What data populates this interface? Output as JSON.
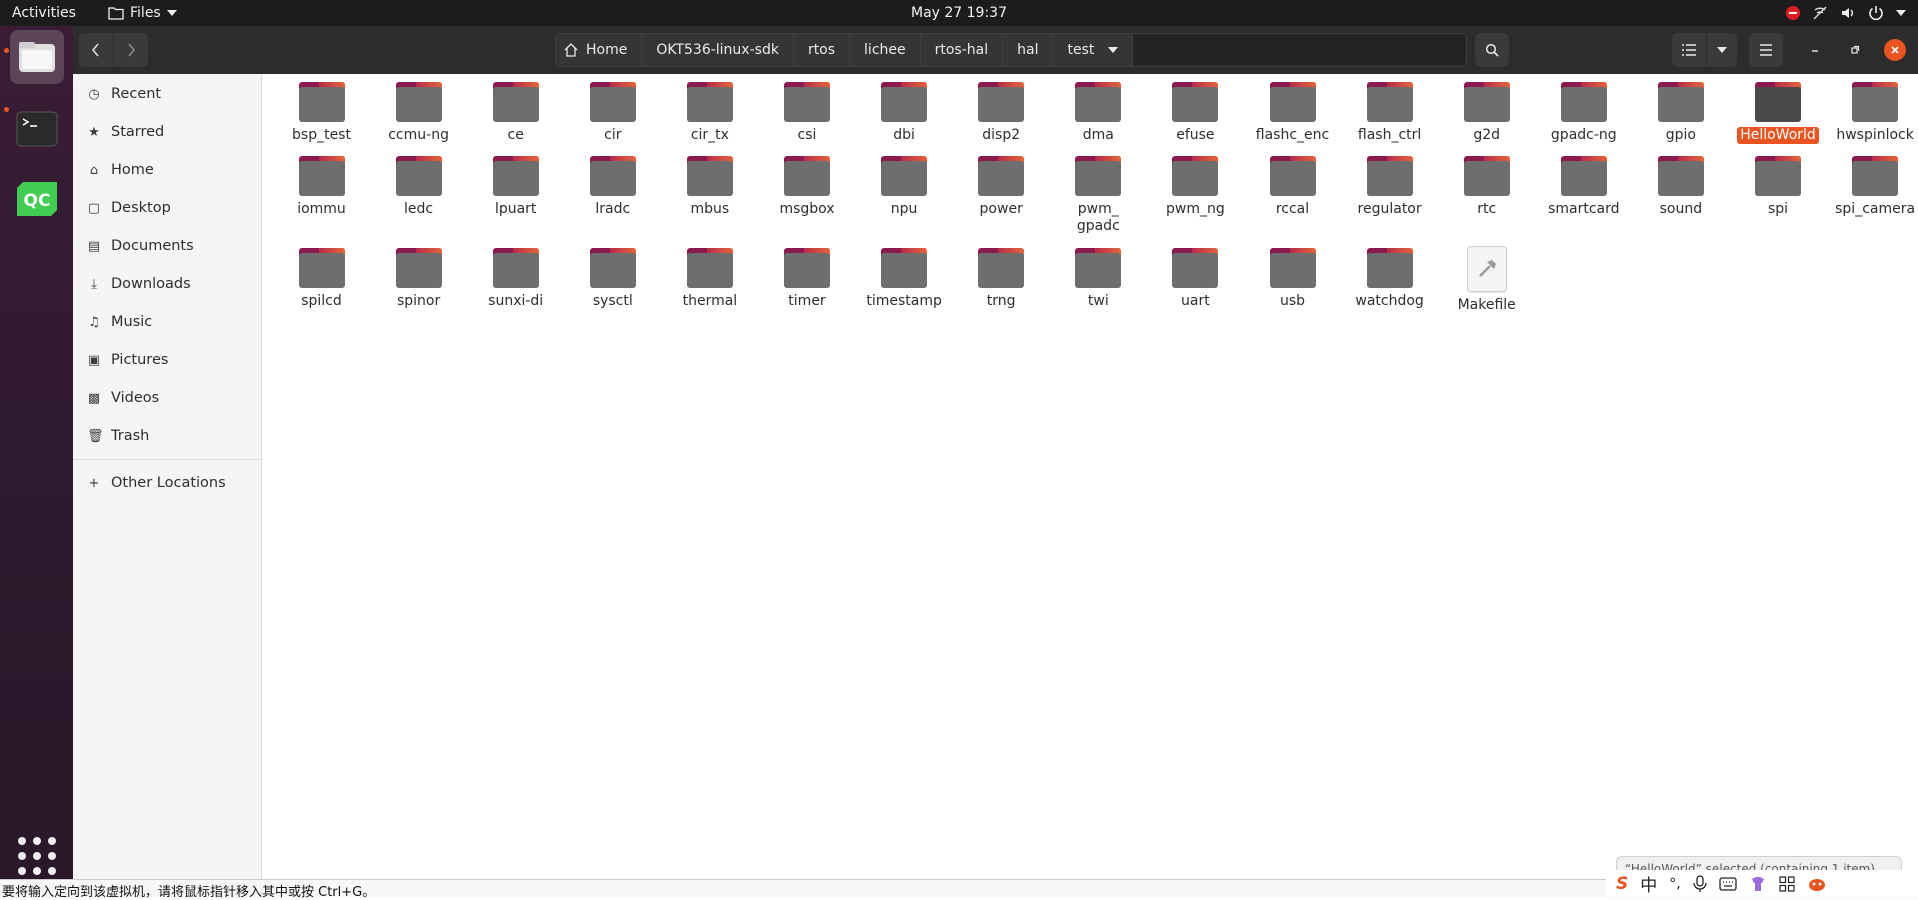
{
  "topbar": {
    "activities": "Activities",
    "app_menu": "Files",
    "clock": "May 27  19:37"
  },
  "header": {
    "breadcrumbs": [
      "Home",
      "OKT536-linux-sdk",
      "rtos",
      "lichee",
      "rtos-hal",
      "hal",
      "test"
    ]
  },
  "sidebar": {
    "items": [
      {
        "label": "Recent",
        "icon": "clock-icon"
      },
      {
        "label": "Starred",
        "icon": "star-icon"
      },
      {
        "label": "Home",
        "icon": "home-icon"
      },
      {
        "label": "Desktop",
        "icon": "desktop-icon"
      },
      {
        "label": "Documents",
        "icon": "document-icon"
      },
      {
        "label": "Downloads",
        "icon": "download-icon"
      },
      {
        "label": "Music",
        "icon": "music-icon"
      },
      {
        "label": "Pictures",
        "icon": "picture-icon"
      },
      {
        "label": "Videos",
        "icon": "video-icon"
      },
      {
        "label": "Trash",
        "icon": "trash-icon"
      }
    ],
    "other_locations": "Other Locations"
  },
  "files": [
    {
      "name": "bsp_test",
      "type": "folder"
    },
    {
      "name": "ccmu-ng",
      "type": "folder"
    },
    {
      "name": "ce",
      "type": "folder"
    },
    {
      "name": "cir",
      "type": "folder"
    },
    {
      "name": "cir_tx",
      "type": "folder"
    },
    {
      "name": "csi",
      "type": "folder"
    },
    {
      "name": "dbi",
      "type": "folder"
    },
    {
      "name": "disp2",
      "type": "folder"
    },
    {
      "name": "dma",
      "type": "folder"
    },
    {
      "name": "efuse",
      "type": "folder"
    },
    {
      "name": "flashc_enc",
      "type": "folder"
    },
    {
      "name": "flash_ctrl",
      "type": "folder"
    },
    {
      "name": "g2d",
      "type": "folder"
    },
    {
      "name": "gpadc-ng",
      "type": "folder"
    },
    {
      "name": "gpio",
      "type": "folder"
    },
    {
      "name": "HelloWorld",
      "type": "folder",
      "selected": true
    },
    {
      "name": "hwspinlock",
      "type": "folder"
    },
    {
      "name": "iommu",
      "type": "folder"
    },
    {
      "name": "ledc",
      "type": "folder"
    },
    {
      "name": "lpuart",
      "type": "folder"
    },
    {
      "name": "lradc",
      "type": "folder"
    },
    {
      "name": "mbus",
      "type": "folder"
    },
    {
      "name": "msgbox",
      "type": "folder"
    },
    {
      "name": "npu",
      "type": "folder"
    },
    {
      "name": "power",
      "type": "folder"
    },
    {
      "name": "pwm_\ngpadc",
      "type": "folder"
    },
    {
      "name": "pwm_ng",
      "type": "folder"
    },
    {
      "name": "rccal",
      "type": "folder"
    },
    {
      "name": "regulator",
      "type": "folder"
    },
    {
      "name": "rtc",
      "type": "folder"
    },
    {
      "name": "smartcard",
      "type": "folder"
    },
    {
      "name": "sound",
      "type": "folder"
    },
    {
      "name": "spi",
      "type": "folder"
    },
    {
      "name": "spi_camera",
      "type": "folder"
    },
    {
      "name": "spilcd",
      "type": "folder"
    },
    {
      "name": "spinor",
      "type": "folder"
    },
    {
      "name": "sunxi-di",
      "type": "folder"
    },
    {
      "name": "sysctl",
      "type": "folder"
    },
    {
      "name": "thermal",
      "type": "folder"
    },
    {
      "name": "timer",
      "type": "folder"
    },
    {
      "name": "timestamp",
      "type": "folder"
    },
    {
      "name": "trng",
      "type": "folder"
    },
    {
      "name": "twi",
      "type": "folder"
    },
    {
      "name": "uart",
      "type": "folder"
    },
    {
      "name": "usb",
      "type": "folder"
    },
    {
      "name": "watchdog",
      "type": "folder"
    },
    {
      "name": "Makefile",
      "type": "makefile"
    }
  ],
  "status": {
    "selection": "“HelloWorld” selected (containing 1 item)"
  },
  "bottom_hint": "要将输入定向到该虚拟机，请将鼠标指针移入其中或按 Ctrl+G。",
  "ime": {
    "brand": "S",
    "mode": "中",
    "punct": "°,"
  },
  "colors": {
    "accent": "#e95420",
    "headerbar": "#2c2c2c",
    "topbar": "#1c1c1c",
    "dock": "#2f1a2f",
    "folder_tab": "#8b1b4f",
    "folder_body": "#6e6e6e"
  }
}
